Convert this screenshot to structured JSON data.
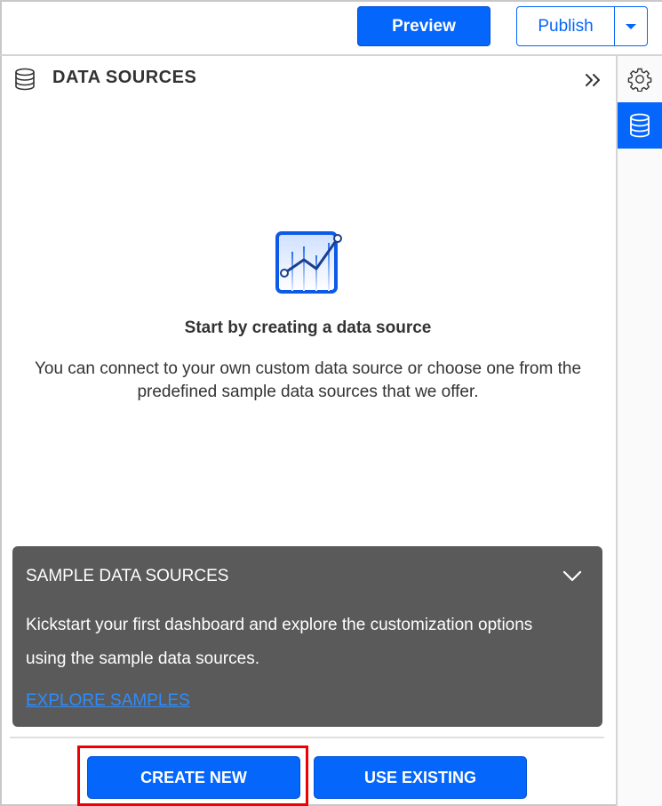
{
  "toolbar": {
    "preview_label": "Preview",
    "publish_label": "Publish",
    "publish_dropdown_icon": "caret-down-icon"
  },
  "rail": {
    "items": [
      {
        "name": "settings",
        "icon": "gear-icon",
        "active": false
      },
      {
        "name": "data-sources",
        "icon": "database-icon",
        "active": true
      }
    ]
  },
  "panel": {
    "title": "DATA SOURCES",
    "title_icon": "database-icon",
    "collapse_icon": "double-chevron-right-icon"
  },
  "empty_state": {
    "icon": "line-chart-icon",
    "title": "Start by creating a data source",
    "description": "You can connect to your own custom data source or choose one from the predefined sample data sources that we offer."
  },
  "sample_card": {
    "title": "SAMPLE DATA SOURCES",
    "toggle_icon": "chevron-down-icon",
    "description": "Kickstart your first dashboard and explore the customization options using the sample data sources.",
    "link_label": "EXPLORE SAMPLES"
  },
  "actions": {
    "create_new_label": "CREATE NEW",
    "use_existing_label": "USE EXISTING"
  },
  "colors": {
    "accent": "#0566fb",
    "card_bg": "#5a5a5a",
    "link": "#2d8cff",
    "highlight": "#ee0000"
  }
}
